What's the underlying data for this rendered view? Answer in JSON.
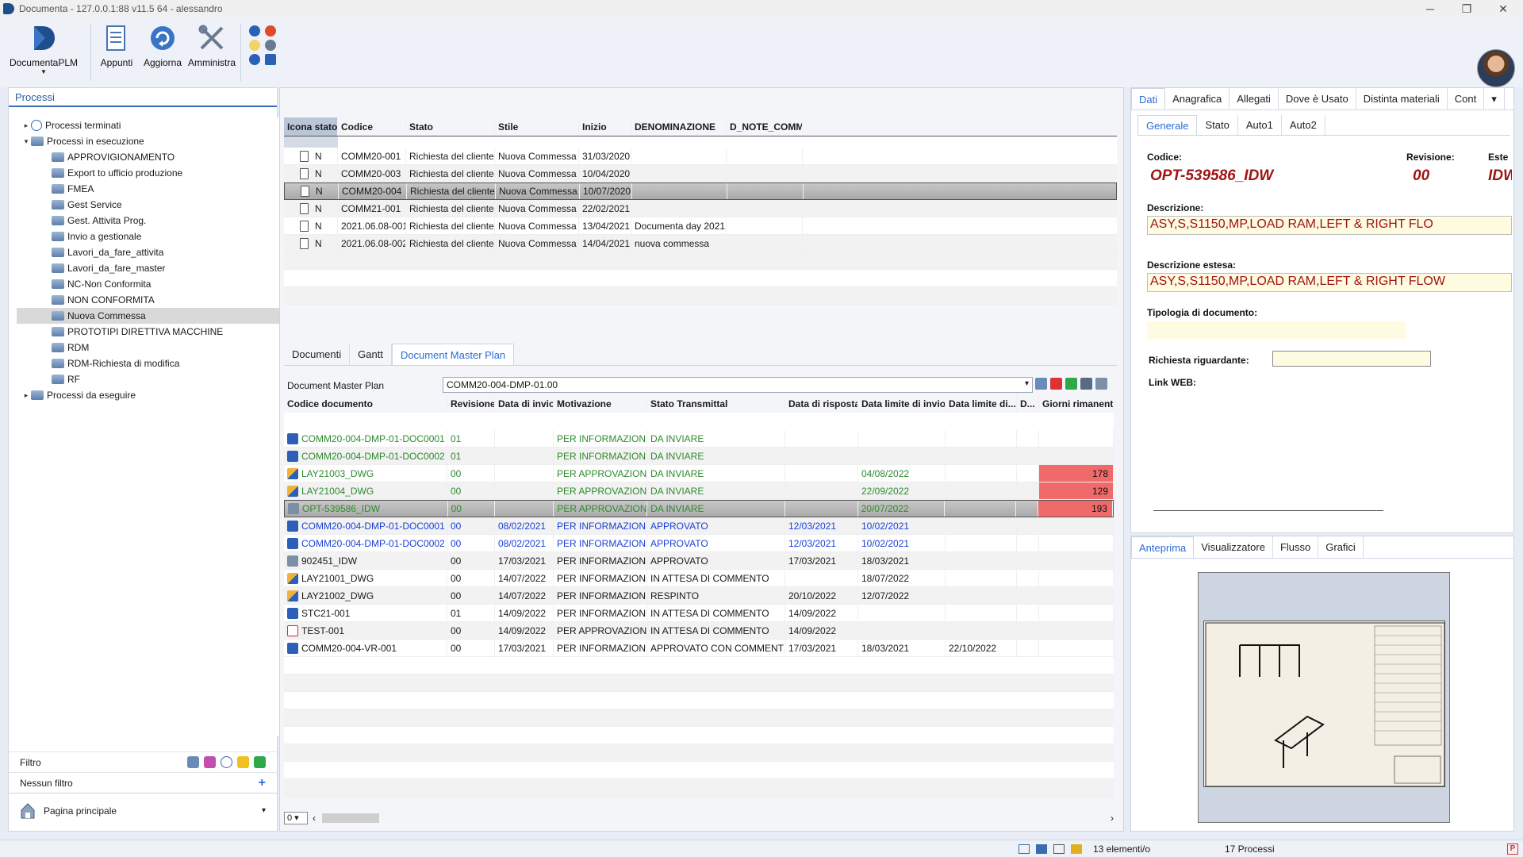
{
  "window": {
    "title": "Documenta - 127.0.0.1:88 v11.5 64 - alessandro",
    "minimize": "─",
    "maximize": "❐",
    "close": "✕"
  },
  "ribbon": {
    "buttons": [
      {
        "label": "DocumentaPLM",
        "icon": "documenta-logo-icon"
      },
      {
        "label": "Appunti",
        "icon": "notes-icon"
      },
      {
        "label": "Aggiorna",
        "icon": "refresh-icon"
      },
      {
        "label": "Amministra",
        "icon": "tools-icon"
      }
    ]
  },
  "left": {
    "title": "Processi",
    "tree": [
      {
        "label": "Processi terminati",
        "level": 0,
        "arrow": "▸",
        "icon": "clock-icon"
      },
      {
        "label": "Processi in esecuzione",
        "level": 0,
        "arrow": "▾",
        "icon": "folder-icon"
      },
      {
        "label": "APPROVIGIONAMENTO",
        "level": 1
      },
      {
        "label": "Export to ufficio produzione",
        "level": 1
      },
      {
        "label": "FMEA",
        "level": 1
      },
      {
        "label": "Gest Service",
        "level": 1
      },
      {
        "label": "Gest. Attivita Prog.",
        "level": 1
      },
      {
        "label": "Invio a gestionale",
        "level": 1
      },
      {
        "label": "Lavori_da_fare_attivita",
        "level": 1
      },
      {
        "label": "Lavori_da_fare_master",
        "level": 1
      },
      {
        "label": "NC-Non Conformita",
        "level": 1
      },
      {
        "label": "NON CONFORMITA",
        "level": 1
      },
      {
        "label": "Nuova Commessa",
        "level": 1,
        "selected": true
      },
      {
        "label": "PROTOTIPI DIRETTIVA MACCHINE",
        "level": 1
      },
      {
        "label": "RDM",
        "level": 1
      },
      {
        "label": "RDM-Richiesta di modifica",
        "level": 1
      },
      {
        "label": "RF",
        "level": 1
      },
      {
        "label": "Processi da eseguire",
        "level": 0,
        "arrow": "▸",
        "icon": "folder-icon"
      }
    ],
    "filter_label": "Filtro",
    "no_filter": "Nessun filtro",
    "add": "+",
    "home": "Pagina principale",
    "home_arrow": "▾"
  },
  "grid1": {
    "columns": [
      "Icona stato",
      "Codice",
      "Stato",
      "Stile",
      "Inizio",
      "DENOMINAZIONE",
      "D_NOTE_COMM"
    ],
    "rows": [
      {
        "flag": "N",
        "codice": "COMM20-001",
        "stato": "Richiesta del cliente",
        "stile": "Nuova Commessa",
        "inizio": "31/03/2020",
        "denom": "",
        "note": ""
      },
      {
        "flag": "N",
        "codice": "COMM20-003",
        "stato": "Richiesta del cliente",
        "stile": "Nuova Commessa",
        "inizio": "10/04/2020",
        "denom": "",
        "note": ""
      },
      {
        "flag": "N",
        "codice": "COMM20-004",
        "stato": "Richiesta del cliente",
        "stile": "Nuova Commessa",
        "inizio": "10/07/2020",
        "denom": "",
        "note": "",
        "selected": true
      },
      {
        "flag": "N",
        "codice": "COMM21-001",
        "stato": "Richiesta del cliente",
        "stile": "Nuova Commessa",
        "inizio": "22/02/2021",
        "denom": "",
        "note": ""
      },
      {
        "flag": "N",
        "codice": "2021.06.08-001",
        "stato": "Richiesta del cliente",
        "stile": "Nuova Commessa",
        "inizio": "13/04/2021",
        "denom": "Documenta day 2021",
        "note": ""
      },
      {
        "flag": "N",
        "codice": "2021.06.08-002",
        "stato": "Richiesta del cliente",
        "stile": "Nuova Commessa",
        "inizio": "14/04/2021",
        "denom": "nuova commessa",
        "note": ""
      }
    ]
  },
  "mid_tabs": [
    "Documenti",
    "Gantt",
    "Document Master Plan"
  ],
  "dmp": {
    "label": "Document Master Plan",
    "value": "COMM20-004-DMP-01.00",
    "arrow": "▾"
  },
  "grid2": {
    "columns": [
      "Codice documento",
      "Revisione",
      "Data di invio",
      "Motivazione",
      "Stato Transmittal",
      "Data di risposta",
      "Data limite di invio",
      "Data limite di...",
      "D...",
      "Giorni rimanenti"
    ],
    "rows": [
      {
        "icon": "word",
        "codice": "COMM20-004-DMP-01-DOC0001",
        "rev": "01",
        "invio": "",
        "motiv": "PER INFORMAZIONE",
        "stato": "DA INVIARE",
        "risposta": "",
        "limite": "",
        "limite2": "",
        "d": "",
        "giorni": "",
        "color": "green"
      },
      {
        "icon": "word",
        "codice": "COMM20-004-DMP-01-DOC0002",
        "rev": "01",
        "invio": "",
        "motiv": "PER INFORMAZIONE",
        "stato": "DA INVIARE",
        "risposta": "",
        "limite": "",
        "limite2": "",
        "d": "",
        "giorni": "",
        "color": "green"
      },
      {
        "icon": "dwg",
        "codice": "LAY21003_DWG",
        "rev": "00",
        "invio": "",
        "motiv": "PER APPROVAZIONE",
        "stato": "DA INVIARE",
        "risposta": "",
        "limite": "04/08/2022",
        "limite2": "",
        "d": "",
        "giorni": "178",
        "color": "green"
      },
      {
        "icon": "dwg",
        "codice": "LAY21004_DWG",
        "rev": "00",
        "invio": "",
        "motiv": "PER APPROVAZIONE",
        "stato": "DA INVIARE",
        "risposta": "",
        "limite": "22/09/2022",
        "limite2": "",
        "d": "",
        "giorni": "129",
        "color": "green"
      },
      {
        "icon": "idw",
        "codice": "OPT-539586_IDW",
        "rev": "00",
        "invio": "",
        "motiv": "PER APPROVAZIONE",
        "stato": "DA INVIARE",
        "risposta": "",
        "limite": "20/07/2022",
        "limite2": "",
        "d": "",
        "giorni": "193",
        "color": "green",
        "selected": true
      },
      {
        "icon": "word",
        "codice": "COMM20-004-DMP-01-DOC0001",
        "rev": "00",
        "invio": "08/02/2021",
        "motiv": "PER INFORMAZIONE",
        "stato": "APPROVATO",
        "risposta": "12/03/2021",
        "limite": "10/02/2021",
        "limite2": "",
        "d": "",
        "giorni": "",
        "color": "blue"
      },
      {
        "icon": "word",
        "codice": "COMM20-004-DMP-01-DOC0002",
        "rev": "00",
        "invio": "08/02/2021",
        "motiv": "PER INFORMAZIONE",
        "stato": "APPROVATO",
        "risposta": "12/03/2021",
        "limite": "10/02/2021",
        "limite2": "",
        "d": "",
        "giorni": "",
        "color": "blue"
      },
      {
        "icon": "idw",
        "codice": "902451_IDW",
        "rev": "00",
        "invio": "17/03/2021",
        "motiv": "PER INFORMAZIONE",
        "stato": "APPROVATO",
        "risposta": "17/03/2021",
        "limite": "18/03/2021",
        "limite2": "",
        "d": "",
        "giorni": "",
        "color": "black"
      },
      {
        "icon": "dwg",
        "codice": "LAY21001_DWG",
        "rev": "00",
        "invio": "14/07/2022",
        "motiv": "PER INFORMAZIONE",
        "stato": "IN ATTESA DI COMMENTO",
        "risposta": "",
        "limite": "18/07/2022",
        "limite2": "",
        "d": "",
        "giorni": "",
        "color": "black"
      },
      {
        "icon": "dwg",
        "codice": "LAY21002_DWG",
        "rev": "00",
        "invio": "14/07/2022",
        "motiv": "PER INFORMAZIONE",
        "stato": "RESPINTO",
        "risposta": "20/10/2022",
        "limite": "12/07/2022",
        "limite2": "",
        "d": "",
        "giorni": "",
        "color": "black"
      },
      {
        "icon": "word",
        "codice": "STC21-001",
        "rev": "01",
        "invio": "14/09/2022",
        "motiv": "PER INFORMAZIONE",
        "stato": "IN ATTESA DI COMMENTO",
        "risposta": "14/09/2022",
        "limite": "",
        "limite2": "",
        "d": "",
        "giorni": "",
        "color": "black"
      },
      {
        "icon": "pdf",
        "codice": "TEST-001",
        "rev": "00",
        "invio": "14/09/2022",
        "motiv": "PER APPROVAZIONE",
        "stato": "IN ATTESA DI COMMENTO",
        "risposta": "14/09/2022",
        "limite": "",
        "limite2": "",
        "d": "",
        "giorni": "",
        "color": "black"
      },
      {
        "icon": "word",
        "codice": "COMM20-004-VR-001",
        "rev": "00",
        "invio": "17/03/2021",
        "motiv": "PER INFORMAZIONE",
        "stato": "APPROVATO CON COMMENTI",
        "risposta": "17/03/2021",
        "limite": "18/03/2021",
        "limite2": "22/10/2022",
        "d": "",
        "giorni": "",
        "color": "black"
      }
    ],
    "zoom": "0",
    "scroll_left": "‹",
    "scroll_right": "›"
  },
  "right": {
    "tabs": [
      "Dati",
      "Anagrafica",
      "Allegati",
      "Dove è Usato",
      "Distinta materiali",
      "Cont"
    ],
    "subtabs": [
      "Generale",
      "Stato",
      "Auto1",
      "Auto2"
    ],
    "codice_label": "Codice:",
    "codice": "OPT-539586_IDW",
    "revisione_label": "Revisione:",
    "revisione": "00",
    "este_label": "Este",
    "este": "IDW",
    "descrizione_label": "Descrizione:",
    "descrizione": "ASY,S,S1150,MP,LOAD RAM,LEFT & RIGHT FLO",
    "descrizione_estesa_label": "Descrizione estesa:",
    "descrizione_estesa": "ASY,S,S1150,MP,LOAD RAM,LEFT & RIGHT FLOW",
    "tipologia_label": "Tipologia di documento:",
    "richiesta_label": "Richiesta riguardante:",
    "link_label": "Link WEB:"
  },
  "preview": {
    "tabs": [
      "Anteprima",
      "Visualizzatore",
      "Flusso",
      "Grafici"
    ]
  },
  "status": {
    "elements": "13 elementi/o",
    "processes": "17 Processi"
  }
}
